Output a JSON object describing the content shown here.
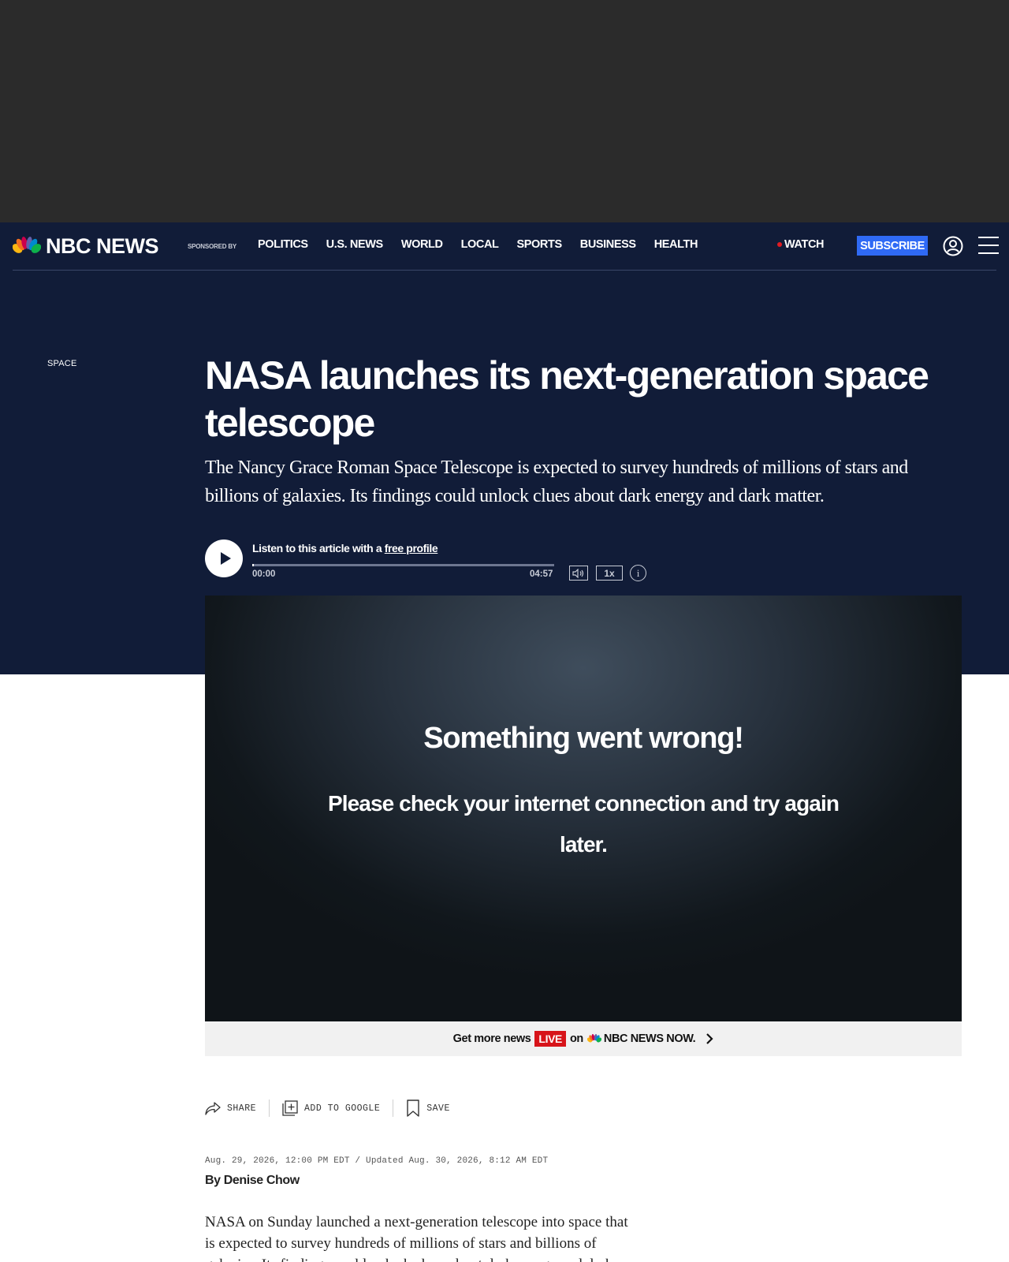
{
  "header": {
    "logo_text": "NBC NEWS",
    "sponsored_label": "SPONSORED BY",
    "nav": [
      "POLITICS",
      "U.S. NEWS",
      "WORLD",
      "LOCAL",
      "SPORTS",
      "BUSINESS",
      "HEALTH"
    ],
    "watch_label": "WATCH",
    "subscribe_label": "SUBSCRIBE"
  },
  "article": {
    "section": "SPACE",
    "headline": "NASA launches its next-generation space telescope",
    "dek": "The Nancy Grace Roman Space Telescope is expected to survey hundreds of millions of stars and billions of galaxies. Its findings could unlock clues about dark energy and dark matter.",
    "timestamp": "Aug. 29, 2026, 12:00 PM EDT / Updated Aug. 30, 2026, 8:12 AM EDT",
    "byline_prefix": "By",
    "byline_author": "Denise Chow",
    "body_first": "NASA on Sunday launched a next-generation telescope into space that is expected to survey hundreds of millions of stars and billions of galaxies. Its findings could unlock clues about dark energy and dark matter."
  },
  "audio": {
    "listen_prefix": "Listen to this article with a",
    "listen_link": "free profile",
    "time_start": "00:00",
    "time_end": "04:57",
    "progress": 0,
    "speed": "1x",
    "info": "i"
  },
  "video": {
    "error_title": "Something went wrong!",
    "error_message": "Please check your internet connection and try again later."
  },
  "promo": {
    "prefix": "Get more news",
    "live": "LIVE",
    "on": "on",
    "brand": "NBC NEWS NOW."
  },
  "actions": {
    "share": "SHARE",
    "add_google": "ADD TO GOOGLE",
    "save": "SAVE"
  },
  "colors": {
    "navy": "#111c38",
    "subscribe_blue": "#2f6af5",
    "live_red": "#d7141a"
  }
}
